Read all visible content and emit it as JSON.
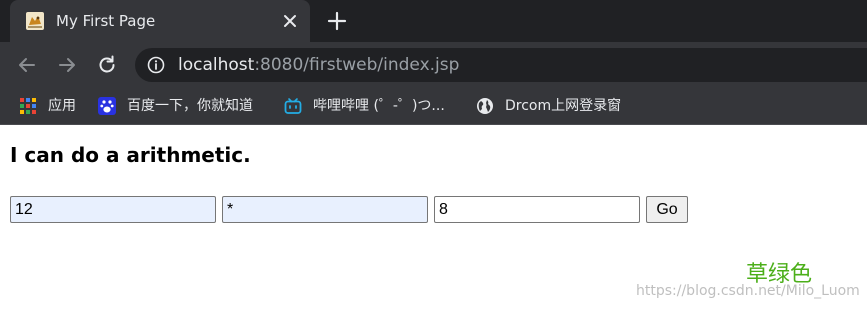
{
  "browser": {
    "tab": {
      "title": "My First Page",
      "favicon": "tomcat-icon",
      "close_icon": "close-icon"
    },
    "new_tab_icon": "plus-icon",
    "toolbar": {
      "back_icon": "back-arrow-icon",
      "forward_icon": "forward-arrow-icon",
      "reload_icon": "reload-icon",
      "info_icon": "info-icon",
      "url_host": "localhost",
      "url_rest": ":8080/firstweb/index.jsp"
    },
    "bookmarks": [
      {
        "label": "应用",
        "icon": "apps-grid-icon"
      },
      {
        "label": "百度一下，你就知道",
        "icon": "baidu-paw-icon"
      },
      {
        "label": "哔哩哔哩 (゜-゜)つ...",
        "icon": "bilibili-tv-icon"
      },
      {
        "label": "Drcom上网登录窗",
        "icon": "globe-icon"
      }
    ]
  },
  "page": {
    "heading": "I can do a arithmetic.",
    "form": {
      "operand1": "12",
      "operator": "*",
      "operand2": "8",
      "submit_label": "Go"
    },
    "green_text": "草绿色",
    "watermark": "https://blog.csdn.net/Milo_Luom"
  },
  "colors": {
    "tabstrip_bg": "#202124",
    "toolbar_bg": "#35363a",
    "omnibox_bg": "#202124",
    "autofill_bg": "#e8f0fe",
    "green_text": "#4caf1a"
  }
}
